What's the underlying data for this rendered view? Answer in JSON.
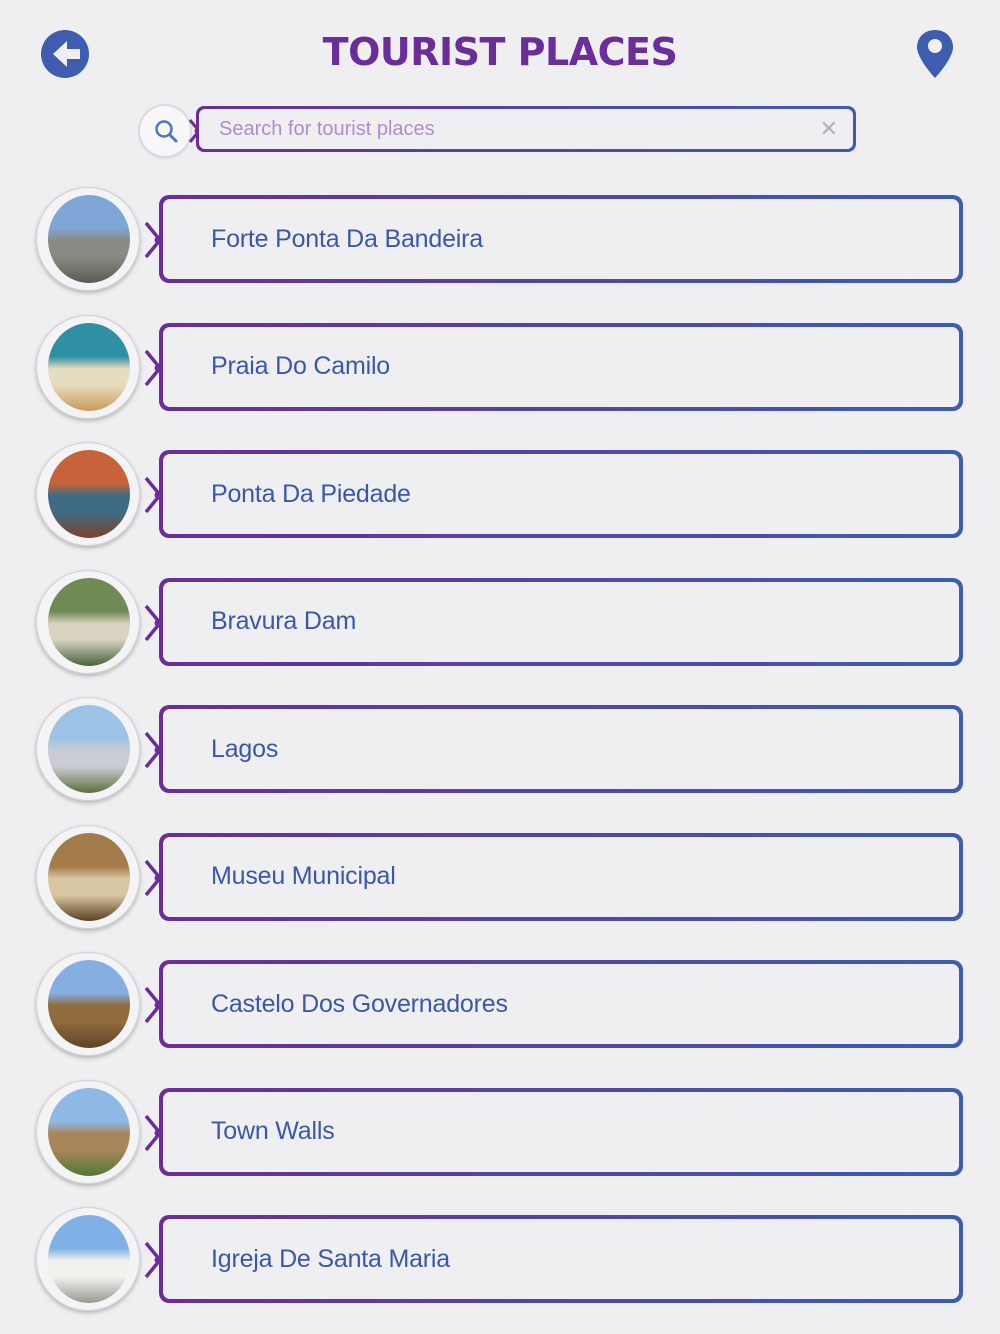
{
  "header": {
    "title": "TOURIST PLACES",
    "back_icon": "back-arrow-icon",
    "map_icon": "map-pin-icon"
  },
  "search": {
    "placeholder": "Search for tourist places",
    "value": "",
    "clear_icon": "close-icon"
  },
  "places": [
    {
      "name": "Forte Ponta Da Bandeira",
      "thumb_colors": [
        "#7fa6d6",
        "#8a8a84",
        "#5c5a52"
      ]
    },
    {
      "name": "Praia Do Camilo",
      "thumb_colors": [
        "#2f8fa3",
        "#e6dcc0",
        "#c99a5a"
      ]
    },
    {
      "name": "Ponta Da Piedade",
      "thumb_colors": [
        "#c8623a",
        "#3e6c86",
        "#7e4128"
      ]
    },
    {
      "name": "Bravura Dam",
      "thumb_colors": [
        "#6e8a55",
        "#d8d2c0",
        "#47633c"
      ]
    },
    {
      "name": "Lagos",
      "thumb_colors": [
        "#9cc3e6",
        "#c9ccd2",
        "#5c6e3e"
      ]
    },
    {
      "name": "Museu Municipal",
      "thumb_colors": [
        "#a47b4b",
        "#d9c7a3",
        "#5a3f24"
      ]
    },
    {
      "name": "Castelo Dos Governadores",
      "thumb_colors": [
        "#86aee0",
        "#8f6b3e",
        "#5e4526"
      ]
    },
    {
      "name": "Town Walls",
      "thumb_colors": [
        "#8fb8e6",
        "#a9865a",
        "#4f7a34"
      ]
    },
    {
      "name": "Igreja De Santa Maria",
      "thumb_colors": [
        "#7fb1e6",
        "#f1f1ee",
        "#9a9a92"
      ]
    }
  ],
  "colors": {
    "title": "#6a2d9a",
    "accent_blue": "#3e5cb0",
    "accent_purple": "#6b2d9b",
    "label": "#3a57ad",
    "background": "#efeff1"
  }
}
